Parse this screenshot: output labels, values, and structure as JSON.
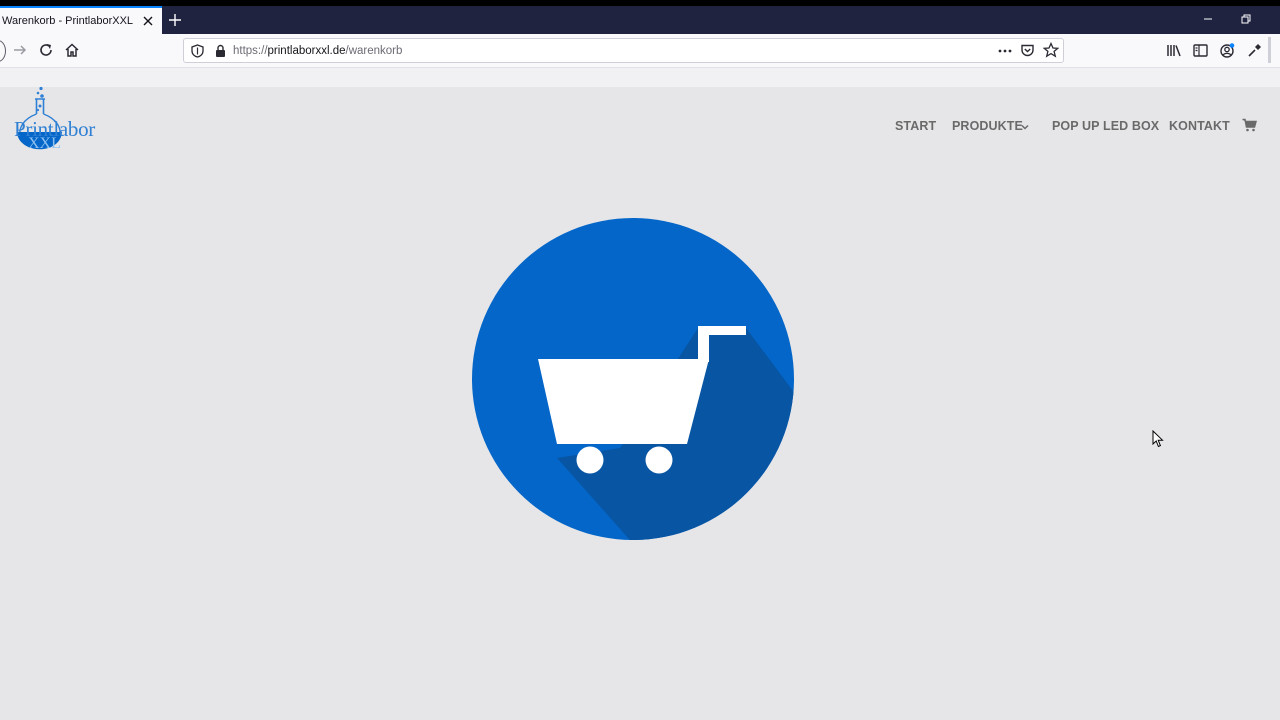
{
  "browser": {
    "tab": {
      "title": "Warenkorb - PrintlaborXXL"
    },
    "address": {
      "scheme": "https://",
      "host": "printlaborxxl.de",
      "path": "/warenkorb"
    },
    "icons": {
      "tab_close": "close-icon",
      "new_tab": "plus-icon",
      "minimize": "minimize-icon",
      "restore": "restore-icon",
      "forward": "arrow-right-icon",
      "reload": "reload-icon",
      "home": "home-icon",
      "tracking": "shield-icon",
      "secure": "lock-icon",
      "page_actions": "more-dots-icon",
      "pocket": "pocket-icon",
      "bookmark": "star-icon",
      "library": "library-icon",
      "sidebar": "sidebar-icon",
      "account": "account-icon",
      "eyedropper": "eyedropper-icon"
    }
  },
  "site": {
    "logo": {
      "text": "Printlabor",
      "sub": "XXL"
    },
    "nav": {
      "items": [
        {
          "label": "START"
        },
        {
          "label": "PRODUKTE",
          "has_dropdown": true
        },
        {
          "label": "POP UP LED BOX"
        },
        {
          "label": "KONTAKT"
        }
      ],
      "cart_icon": "cart-icon"
    },
    "illustration": {
      "icon": "shopping-cart-icon",
      "circle_color": "#0466c8",
      "shadow_color": "#0755a3",
      "cart_color": "#ffffff"
    }
  },
  "colors": {
    "page_bg": "#e6e6e8",
    "tabstrip_bg": "#202340",
    "nav_text": "#6a6a6a",
    "brand_blue": "#2f80d4"
  }
}
